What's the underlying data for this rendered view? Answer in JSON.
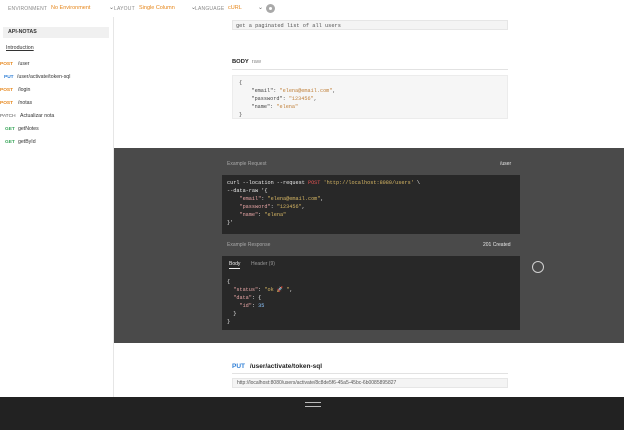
{
  "topbar": {
    "environment_label": "ENVIRONMENT",
    "environment_value": "No Environment",
    "layout_label": "LAYOUT",
    "layout_value": "Single Column",
    "language_label": "LANGUAGE",
    "language_value": "cURL"
  },
  "sidebar": {
    "title": "API-NOTAS",
    "intro": "Introduction",
    "items": [
      {
        "method": "POST",
        "label": "/user",
        "color": "#e6861a"
      },
      {
        "method": "PUT",
        "label": "/user/activate/token-sql",
        "color": "#2f7fd6"
      },
      {
        "method": "POST",
        "label": "/login",
        "color": "#e6861a"
      },
      {
        "method": "POST",
        "label": "/notas",
        "color": "#e6861a"
      },
      {
        "method": "PATCH",
        "label": "Actualizar nota",
        "color": "#555555"
      },
      {
        "method": "GET",
        "label": "getNotes",
        "color": "#39a65a"
      },
      {
        "method": "GET",
        "label": "getById",
        "color": "#39a65a"
      }
    ]
  },
  "main": {
    "description": "get a paginated list of all users",
    "body_label": "BODY",
    "body_type": "raw",
    "body_lines": [
      "{",
      "    \"email\": ",
      "\"elena@email.com\"",
      ",",
      "    \"password\": ",
      "\"123456\"",
      ",",
      "    \"name\": ",
      "\"elena\"",
      "}"
    ],
    "example_request_label": "Example Request",
    "example_request_path": "/user",
    "curl": {
      "l1a": "curl --location --request ",
      "l1b": "POST",
      "l1c": " ",
      "l1d": "'http://localhost:8080/users'",
      "l1e": " \\",
      "l2": "--data-raw '{",
      "email_key": "    \"email\"",
      "email_val": "\"elena@email.com\"",
      "password_key": "    \"password\"",
      "password_val": "\"123456\"",
      "name_key": "    \"name\"",
      "name_val": "\"elena\"",
      "l_end": "}'"
    },
    "example_response_label": "Example Response",
    "response_status": "201 Created",
    "response_tabs": {
      "body": "Body",
      "header": "Header",
      "header_count": "(9)"
    },
    "response": {
      "status_key": "  \"status\"",
      "status_val": "\"ok 🚀 \"",
      "data_key": "  \"data\"",
      "id_key": "    \"id\"",
      "id_val": "35"
    },
    "put_method": "PUT",
    "put_path": "/user/activate/token-sql",
    "put_url": "http://localhost:8080/users/activate/8c8de5f6-45a5-45bc-6b0085895827"
  },
  "colors": {
    "accent": "#e6861a",
    "put": "#2f7fd6",
    "get": "#39a65a"
  }
}
